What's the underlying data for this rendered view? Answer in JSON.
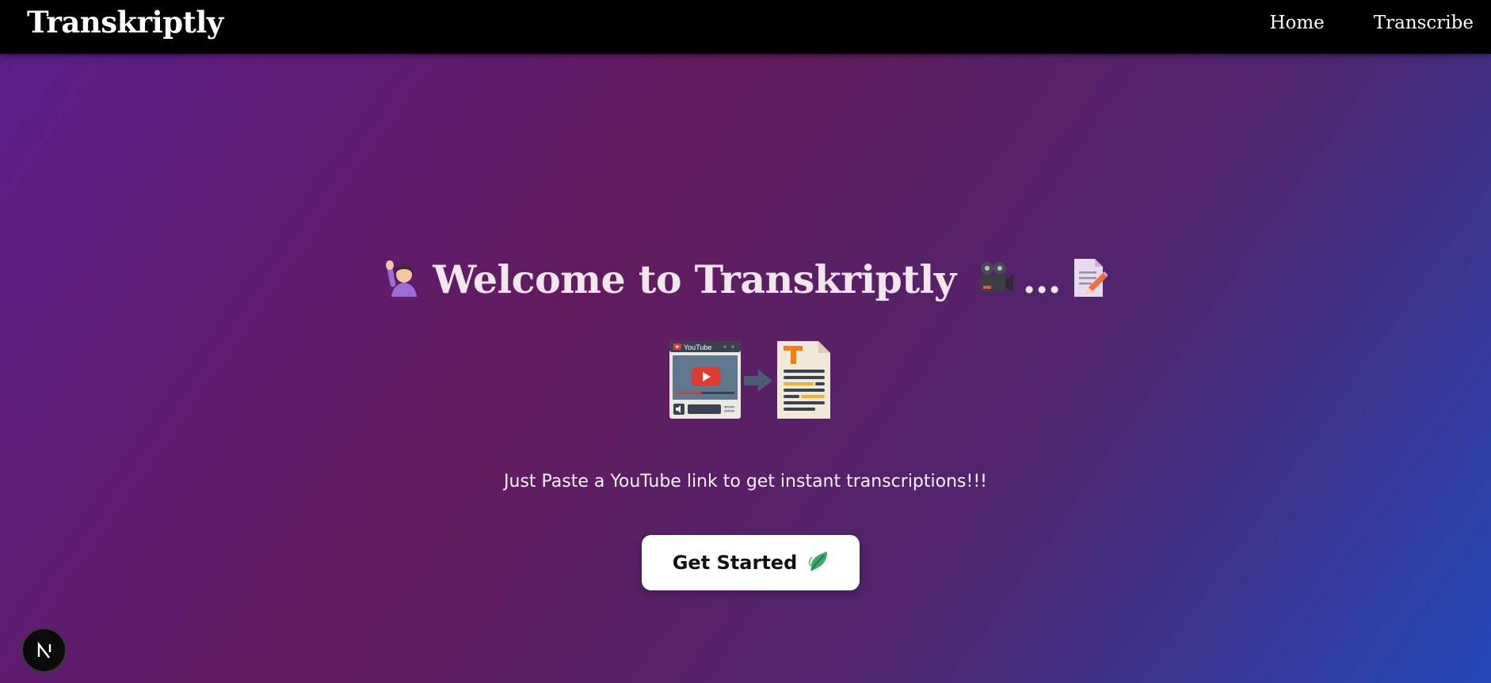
{
  "navbar": {
    "brand": "Transkriptly",
    "links": [
      {
        "label": "Home"
      },
      {
        "label": "Transcribe"
      }
    ]
  },
  "hero": {
    "title": "Welcome to Transkriptly",
    "title_prefix_icon": "person-raising-hand-icon",
    "title_suffix_icons": [
      "movie-camera-icon",
      "ellipsis",
      "memo-pencil-icon"
    ],
    "illustration": {
      "icons": [
        "youtube-player-icon",
        "arrow-right-icon",
        "text-document-icon"
      ],
      "youtube_label": "YouTube",
      "doc_letter": "T"
    },
    "tagline": "Just Paste a YouTube link to get instant transcriptions!!!",
    "cta_label": "Get Started",
    "cta_icon": "leaf-icon"
  },
  "badge": {
    "letter": "N",
    "icon": "nextjs-icon"
  },
  "colors": {
    "navbar_bg": "#000000",
    "gradient_start": "#5a1d8c",
    "gradient_mid": "#621c5d",
    "gradient_end": "#2447b8",
    "cta_bg": "#ffffff",
    "youtube_red": "#e03b2e",
    "arrow": "#4a5b73"
  }
}
